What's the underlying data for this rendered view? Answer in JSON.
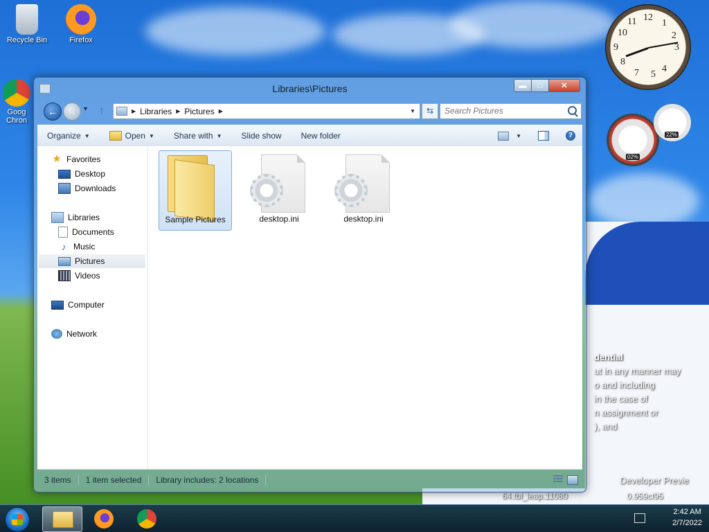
{
  "desktop": {
    "icons": [
      {
        "label": "Recycle Bin",
        "icon": "recycle-bin-icon"
      },
      {
        "label": "Firefox",
        "icon": "firefox-icon"
      },
      {
        "label": "Goog\nChron",
        "icon": "chrome-icon"
      }
    ],
    "overlay_text": [
      "dential",
      "ut in any manner may",
      "o and including",
      "in the case of",
      "n assignment or",
      "), and",
      "Developer Previe",
      "64.fbl_leap.11080",
      "0.959cf95"
    ]
  },
  "gadgets": {
    "clock_numbers": [
      "12",
      "1",
      "2",
      "3",
      "4",
      "5",
      "6",
      "7",
      "8",
      "9",
      "10",
      "11"
    ],
    "cpu_meter": {
      "cpu": "02%",
      "memory": "22%"
    }
  },
  "window": {
    "title": "Libraries\\Pictures",
    "address": {
      "crumbs": [
        "Libraries",
        "Pictures"
      ]
    },
    "search": {
      "placeholder": "Search Pictures"
    },
    "commands": {
      "organize": "Organize",
      "open": "Open",
      "share_with": "Share with",
      "slide_show": "Slide show",
      "new_folder": "New folder"
    },
    "nav": {
      "favorites": "Favorites",
      "desktop": "Desktop",
      "downloads": "Downloads",
      "libraries": "Libraries",
      "documents": "Documents",
      "music": "Music",
      "pictures": "Pictures",
      "videos": "Videos",
      "computer": "Computer",
      "network": "Network"
    },
    "files": [
      {
        "name": "Sample Pictures",
        "type": "folder",
        "selected": true
      },
      {
        "name": "desktop.ini",
        "type": "ini",
        "selected": false
      },
      {
        "name": "desktop.ini",
        "type": "ini",
        "selected": false
      }
    ],
    "status": {
      "items": "3 items",
      "selected": "1 item selected",
      "library": "Library includes: 2 locations"
    }
  },
  "taskbar": {
    "time": "2:42 AM",
    "date": "2/7/2022"
  },
  "colors": {
    "accent": "#1b4f9a",
    "selection": "#cfe2f6"
  }
}
